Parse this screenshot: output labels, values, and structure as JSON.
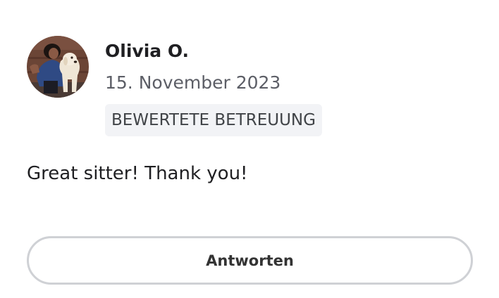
{
  "review": {
    "reviewer_name": "Olivia O.",
    "date": "15. November 2023",
    "service_badge": "BEWERTETE BETREUUNG",
    "text": "Great sitter! Thank you!",
    "avatar_icon": "reviewer-photo-with-dog"
  },
  "actions": {
    "reply_label": "Antworten"
  },
  "colors": {
    "text_primary": "#1f1f22",
    "text_secondary": "#5c5e66",
    "badge_background": "#f2f3f6",
    "button_border": "#cfd1d5"
  }
}
